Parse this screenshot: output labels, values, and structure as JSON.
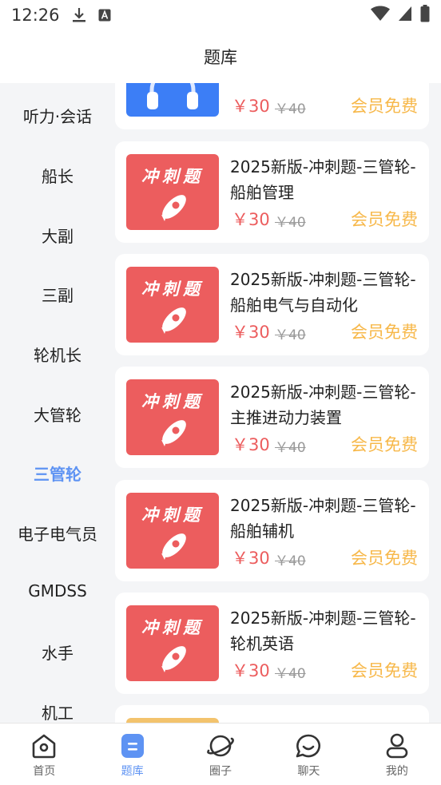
{
  "status_bar": {
    "time": "12:26"
  },
  "app_bar": {
    "title": "题库"
  },
  "sidebar": {
    "items": [
      {
        "label": "听力·会话"
      },
      {
        "label": "船长"
      },
      {
        "label": "大副"
      },
      {
        "label": "三副"
      },
      {
        "label": "轮机长"
      },
      {
        "label": "大管轮"
      },
      {
        "label": "三管轮",
        "active": true
      },
      {
        "label": "电子电气员"
      },
      {
        "label": "GMDSS"
      },
      {
        "label": "水手"
      },
      {
        "label": "机工"
      }
    ]
  },
  "thumb_text": "冲刺题",
  "courses": [
    {
      "title": "2025新版-冲刺题-三管轮-船舶管理",
      "price": "￥30",
      "orig": "￥40",
      "free": "会员免费"
    },
    {
      "title": "2025新版-冲刺题-三管轮-船舶电气与自动化",
      "price": "￥30",
      "orig": "￥40",
      "free": "会员免费"
    },
    {
      "title": "2025新版-冲刺题-三管轮-主推进动力装置",
      "price": "￥30",
      "orig": "￥40",
      "free": "会员免费"
    },
    {
      "title": "2025新版-冲刺题-三管轮-船舶辅机",
      "price": "￥30",
      "orig": "￥40",
      "free": "会员免费"
    },
    {
      "title": "2025新版-冲刺题-三管轮-轮机英语",
      "price": "￥30",
      "orig": "￥40",
      "free": "会员免费"
    }
  ],
  "partial_top": {
    "price": "￥30",
    "orig": "￥40",
    "free": "会员免费"
  },
  "tabs": [
    {
      "label": "首页",
      "icon": "home-icon"
    },
    {
      "label": "题库",
      "icon": "question-bank-icon",
      "active": true
    },
    {
      "label": "圈子",
      "icon": "planet-icon"
    },
    {
      "label": "聊天",
      "icon": "chat-icon"
    },
    {
      "label": "我的",
      "icon": "profile-icon"
    }
  ],
  "colors": {
    "accent": "#5e93f3",
    "price": "#ec5d5e",
    "free": "#f7b84a"
  }
}
